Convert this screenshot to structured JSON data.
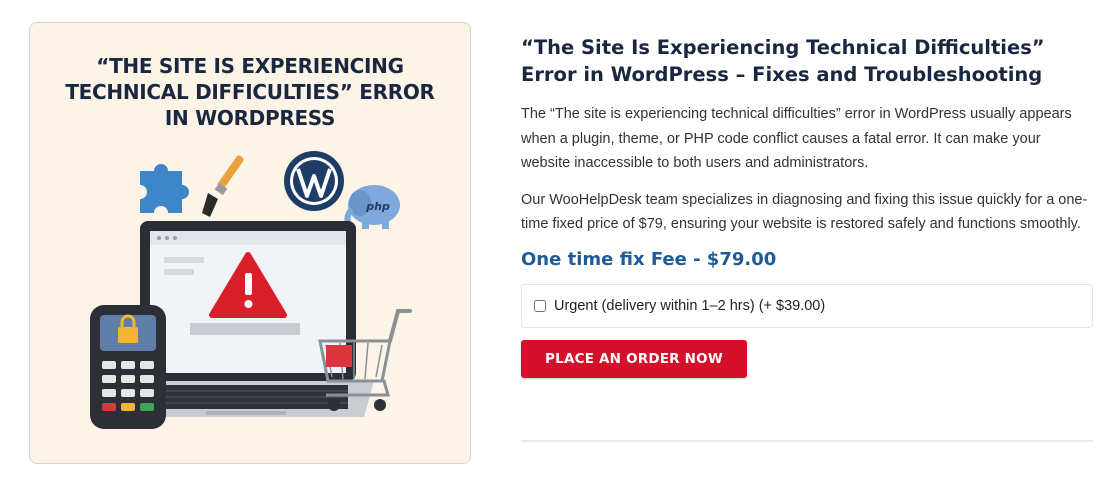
{
  "image": {
    "headline_lines": [
      "“THE SITE IS EXPERIENCING",
      "TECHNICAL DIFFICULTIES” ERROR",
      "IN WORDPRESS"
    ],
    "php_logo_text": "php"
  },
  "product": {
    "title_lines": [
      "“The Site Is Experiencing Technical Difficulties”",
      "Error in WordPress – Fixes and Troubleshooting"
    ],
    "description_1": "The “The site is experiencing technical difficulties” error in WordPress usually appears when a plugin, theme, or PHP code conflict causes a fatal error. It can make your website inaccessible to both users and administrators.",
    "description_2": "Our WooHelpDesk team specializes in diagnosing and fixing this issue quickly for a one-time fixed price of $79, ensuring your website is restored safely and functions smoothly.",
    "price_label": "One time fix Fee - $79.00",
    "addon_label": "Urgent (delivery within 1–2 hrs) (+ $39.00)",
    "addon_checked": false,
    "order_button_label": "PLACE AN ORDER NOW"
  },
  "colors": {
    "title": "#1a2740",
    "price": "#1f5b96",
    "button": "#d4112a",
    "image_bg": "#fdf3e6"
  }
}
